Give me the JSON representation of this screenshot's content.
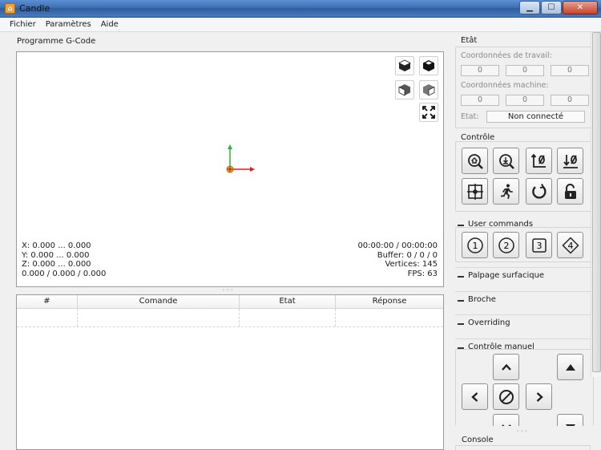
{
  "window": {
    "title": "Candle",
    "minimize": "▁",
    "maximize": "☐",
    "close": "✕"
  },
  "menu": [
    "Fichier",
    "Paramètres",
    "Aide"
  ],
  "gcode": {
    "title": "Programme G-Code",
    "stats_left": [
      "X: 0.000 ... 0.000",
      "Y: 0.000 ... 0.000",
      "Z: 0.000 ... 0.000",
      "0.000 / 0.000 / 0.000"
    ],
    "stats_right": [
      "00:00:00 / 00:00:00",
      "Buffer: 0 / 0 / 0",
      "Vertices: 145",
      "FPS: 63"
    ]
  },
  "table": {
    "headers": [
      "#",
      "Comande",
      "Etat",
      "Réponse"
    ]
  },
  "state": {
    "title": "Etât",
    "work_coords_label": "Coordonnées de travail:",
    "work_coords": [
      "0",
      "0",
      "0"
    ],
    "machine_coords_label": "Coordonnées machine:",
    "machine_coords": [
      "0",
      "0",
      "0"
    ],
    "status_label": "Etat:",
    "status_value": "Non connecté"
  },
  "control": {
    "title": "Contrôle"
  },
  "user_commands": {
    "title": "User commands",
    "buttons": [
      "1",
      "2",
      "3",
      "4"
    ]
  },
  "collapsibles": [
    "Palpage surfacique",
    "Broche",
    "Overriding"
  ],
  "manual": {
    "title": "Contrôle manuel"
  },
  "console": {
    "title": "Console"
  },
  "splitter": "◦◦◦"
}
